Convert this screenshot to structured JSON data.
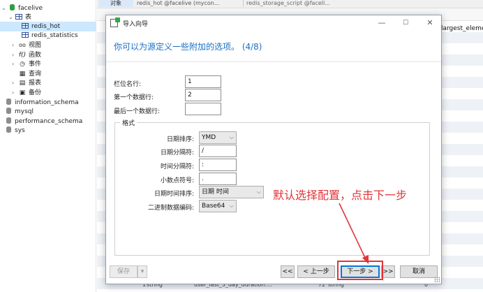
{
  "tree": {
    "items": [
      {
        "label": "facelive",
        "icon": "database-icon",
        "level": 1,
        "expanded": true
      },
      {
        "label": "表",
        "icon": "table-folder-icon",
        "level": 2,
        "expanded": true
      },
      {
        "label": "redis_hot",
        "icon": "table-icon",
        "level": 3,
        "selected": true
      },
      {
        "label": "redis_statistics",
        "icon": "table-icon",
        "level": 3
      },
      {
        "label": "视图",
        "icon": "view-icon",
        "level": 2,
        "expanded": false
      },
      {
        "label": "函数",
        "icon": "function-icon",
        "level": 2,
        "expanded": false
      },
      {
        "label": "事件",
        "icon": "event-icon",
        "level": 2,
        "expanded": false
      },
      {
        "label": "查询",
        "icon": "query-icon",
        "level": 2
      },
      {
        "label": "报表",
        "icon": "report-icon",
        "level": 2,
        "expanded": false
      },
      {
        "label": "备份",
        "icon": "backup-icon",
        "level": 2,
        "expanded": false
      },
      {
        "label": "information_schema",
        "icon": "database-icon",
        "level": 1
      },
      {
        "label": "mysql",
        "icon": "database-icon",
        "level": 1
      },
      {
        "label": "performance_schema",
        "icon": "database-icon",
        "level": 1
      },
      {
        "label": "sys",
        "icon": "database-icon",
        "level": 1
      }
    ]
  },
  "background": {
    "tab_object": "对象",
    "tab_1": "redis_hot @facelive (mycon...",
    "tab_2": "redis_storage_script @facell...",
    "column_header": "largest_eleme",
    "bottom_row": {
      "num": "1",
      "type1": "string",
      "name": "user_last_3_day_duration:...",
      "num2": "72",
      "type2": "string",
      "val": "0"
    }
  },
  "dialog": {
    "title": "导入向导",
    "subtitle": "你可以为源定义一些附加的选项。 (4/8)",
    "fields": {
      "field_name_row_label": "栏位名行:",
      "field_name_row_value": "1",
      "first_data_row_label": "第一个数据行:",
      "first_data_row_value": "2",
      "last_data_row_label": "最后一个数据行:",
      "last_data_row_value": ""
    },
    "format": {
      "legend": "格式",
      "date_order_label": "日期排序:",
      "date_order_value": "YMD",
      "date_delimiter_label": "日期分隔符:",
      "date_delimiter_value": "/",
      "time_delimiter_label": "时间分隔符:",
      "time_delimiter_value": ":",
      "decimal_symbol_label": "小数点符号:",
      "decimal_symbol_value": ".",
      "datetime_order_label": "日期时间排序:",
      "datetime_order_value": "日期 时间",
      "binary_encoding_label": "二进制数据编码:",
      "binary_encoding_value": "Base64"
    },
    "buttons": {
      "save": "保存",
      "first": "<<",
      "prev": "< 上一步",
      "next": "下一步 >",
      "last": ">>",
      "cancel": "取消"
    }
  },
  "annotation": {
    "text": "默认选择配置，点击下一步",
    "color": "#e1343a"
  },
  "colors": {
    "accent": "#1a6fc4",
    "selection": "#cce8ff",
    "annotation": "#e1343a"
  }
}
